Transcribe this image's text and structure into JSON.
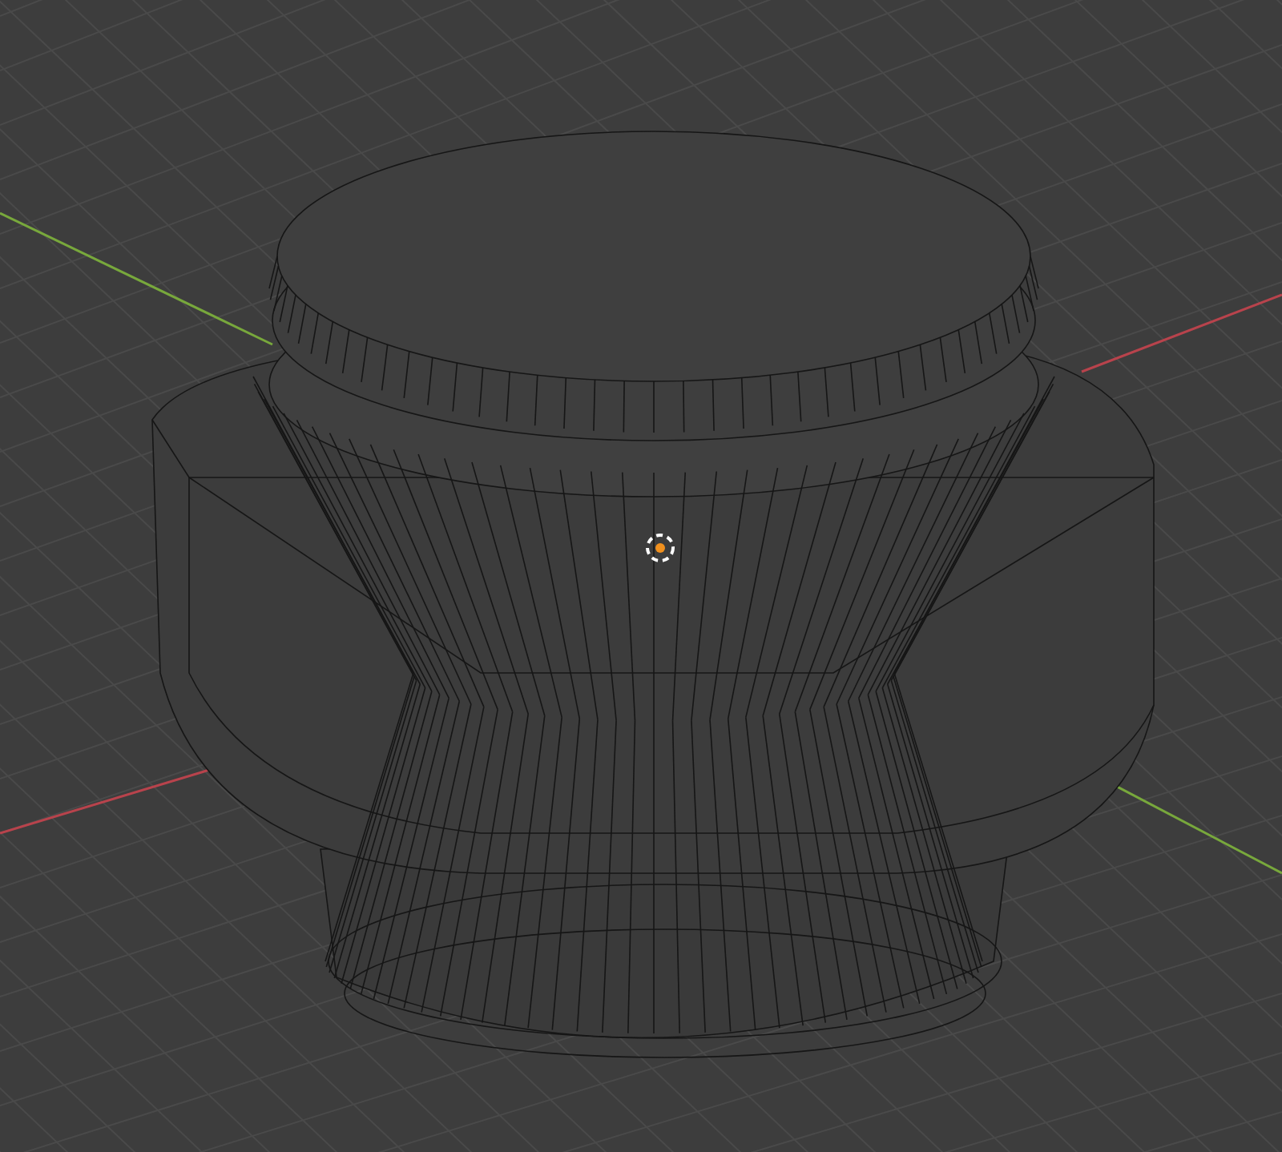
{
  "viewport": {
    "axes": [
      {
        "kind": "x",
        "color": "#b8434c"
      },
      {
        "kind": "y",
        "color": "#78a83c"
      }
    ]
  }
}
